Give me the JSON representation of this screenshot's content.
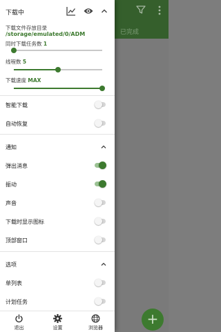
{
  "background": {
    "tab_label": "已完成",
    "fab_symbol": "+"
  },
  "drawer": {
    "header": {
      "title": "下载中",
      "icons": [
        "chart-icon",
        "eye-icon",
        "chevron-up-icon"
      ]
    },
    "download_dir": {
      "label": "下载文件存放目录",
      "value": "/storage/emulated/0/ADM"
    },
    "concurrent": {
      "label": "同时下载任务数",
      "value": "1",
      "level": 0.0
    },
    "threads": {
      "label": "线程数",
      "value": "5",
      "level": 0.5
    },
    "speed": {
      "label": "下载速度",
      "value": "MAX",
      "level": 1.0
    },
    "download_toggles": [
      {
        "label": "智能下载",
        "on": false
      },
      {
        "label": "自动恢复",
        "on": false
      }
    ],
    "notifications": {
      "title": "通知",
      "items": [
        {
          "label": "弹出消息",
          "on": true
        },
        {
          "label": "振动",
          "on": true
        },
        {
          "label": "声音",
          "on": false
        },
        {
          "label": "下载时显示图标",
          "on": false
        },
        {
          "label": "顶部窗口",
          "on": false
        }
      ]
    },
    "options": {
      "title": "选项",
      "items": [
        {
          "label": "单列表",
          "on": false
        },
        {
          "label": "计划任务",
          "on": false
        }
      ]
    }
  },
  "bottom_nav": {
    "items": [
      {
        "label": "退出",
        "icon": "power-icon"
      },
      {
        "label": "设置",
        "icon": "gear-icon"
      },
      {
        "label": "浏览器",
        "icon": "globe-icon"
      }
    ]
  },
  "colors": {
    "accent": "#3d7a2f",
    "accent_light": "#9cc294",
    "appbar": "#355f2c",
    "scrim": "#7a7a7a"
  }
}
